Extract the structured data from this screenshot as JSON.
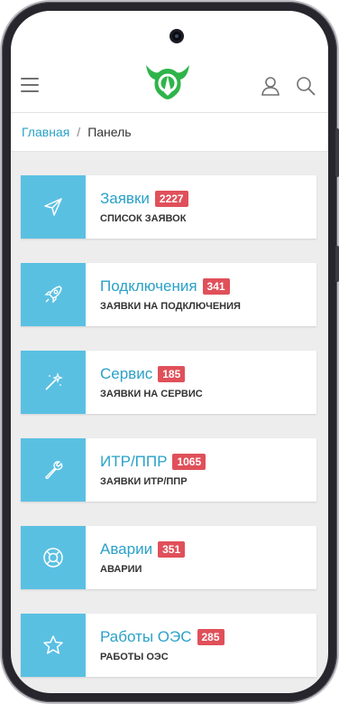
{
  "header": {
    "menu_icon": "hamburger-icon",
    "logo": "brand-logo",
    "user_icon": "user-icon",
    "search_icon": "search-icon",
    "accent_color": "#5ac0e2",
    "badge_color": "#e0505a",
    "logo_color": "#2fb44a"
  },
  "breadcrumb": {
    "home": "Главная",
    "separator": "/",
    "current": "Панель"
  },
  "cards": [
    {
      "title": "Заявки",
      "count": "2227",
      "subtitle": "СПИСОК ЗАЯВОК",
      "icon": "send-icon"
    },
    {
      "title": "Подключения",
      "count": "341",
      "subtitle": "ЗАЯВКИ НА ПОДКЛЮЧЕНИЯ",
      "icon": "rocket-icon"
    },
    {
      "title": "Сервис",
      "count": "185",
      "subtitle": "ЗАЯВКИ НА СЕРВИС",
      "icon": "magic-wand-icon"
    },
    {
      "title": "ИТР/ППР",
      "count": "1065",
      "subtitle": "ЗАЯВКИ ИТР/ППР",
      "icon": "wrench-icon"
    },
    {
      "title": "Аварии",
      "count": "351",
      "subtitle": "АВАРИИ",
      "icon": "lifebuoy-icon"
    },
    {
      "title": "Работы ОЭС",
      "count": "285",
      "subtitle": "РАБОТЫ ОЭС",
      "icon": "star-icon"
    }
  ]
}
